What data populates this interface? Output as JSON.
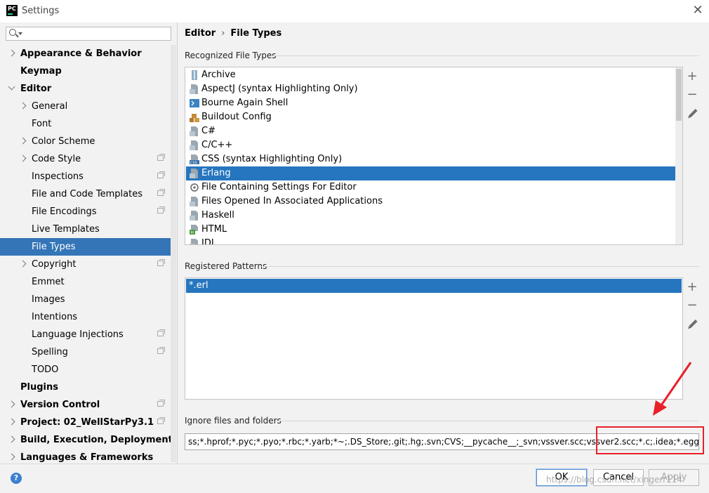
{
  "window": {
    "title": "Settings",
    "app_icon": "PC"
  },
  "search": {
    "placeholder": ""
  },
  "sidebar": {
    "items": [
      {
        "label": "Appearance & Behavior",
        "bold": true,
        "level": 0,
        "arrow": "right"
      },
      {
        "label": "Keymap",
        "bold": true,
        "level": 0,
        "arrow": ""
      },
      {
        "label": "Editor",
        "bold": true,
        "level": 0,
        "arrow": "down"
      },
      {
        "label": "General",
        "bold": false,
        "level": 1,
        "arrow": "right"
      },
      {
        "label": "Font",
        "bold": false,
        "level": 1,
        "arrow": ""
      },
      {
        "label": "Color Scheme",
        "bold": false,
        "level": 1,
        "arrow": "right"
      },
      {
        "label": "Code Style",
        "bold": false,
        "level": 1,
        "arrow": "right",
        "project": true
      },
      {
        "label": "Inspections",
        "bold": false,
        "level": 1,
        "arrow": "",
        "project": true
      },
      {
        "label": "File and Code Templates",
        "bold": false,
        "level": 1,
        "arrow": "",
        "project": true
      },
      {
        "label": "File Encodings",
        "bold": false,
        "level": 1,
        "arrow": "",
        "project": true
      },
      {
        "label": "Live Templates",
        "bold": false,
        "level": 1,
        "arrow": ""
      },
      {
        "label": "File Types",
        "bold": false,
        "level": 1,
        "arrow": "",
        "selected": true
      },
      {
        "label": "Copyright",
        "bold": false,
        "level": 1,
        "arrow": "right",
        "project": true
      },
      {
        "label": "Emmet",
        "bold": false,
        "level": 1,
        "arrow": ""
      },
      {
        "label": "Images",
        "bold": false,
        "level": 1,
        "arrow": ""
      },
      {
        "label": "Intentions",
        "bold": false,
        "level": 1,
        "arrow": ""
      },
      {
        "label": "Language Injections",
        "bold": false,
        "level": 1,
        "arrow": "",
        "project": true
      },
      {
        "label": "Spelling",
        "bold": false,
        "level": 1,
        "arrow": "",
        "project": true
      },
      {
        "label": "TODO",
        "bold": false,
        "level": 1,
        "arrow": ""
      },
      {
        "label": "Plugins",
        "bold": true,
        "level": 0,
        "arrow": ""
      },
      {
        "label": "Version Control",
        "bold": true,
        "level": 0,
        "arrow": "right",
        "project": true
      },
      {
        "label": "Project: 02_WellStarPy3.1",
        "bold": true,
        "level": 0,
        "arrow": "right",
        "project": true
      },
      {
        "label": "Build, Execution, Deployment",
        "bold": true,
        "level": 0,
        "arrow": "right"
      },
      {
        "label": "Languages & Frameworks",
        "bold": true,
        "level": 0,
        "arrow": "right"
      }
    ]
  },
  "breadcrumb": {
    "parent": "Editor",
    "separator": "›",
    "current": "File Types"
  },
  "recognized": {
    "label": "Recognized File Types",
    "items": [
      {
        "label": "Archive",
        "icon": "archive-icon"
      },
      {
        "label": "AspectJ (syntax Highlighting Only)",
        "icon": "file-icon"
      },
      {
        "label": "Bourne Again Shell",
        "icon": "shell-icon"
      },
      {
        "label": "Buildout Config",
        "icon": "buildout-icon"
      },
      {
        "label": "C#",
        "icon": "file-icon"
      },
      {
        "label": "C/C++",
        "icon": "file-icon"
      },
      {
        "label": "CSS (syntax Highlighting Only)",
        "icon": "css-icon"
      },
      {
        "label": "Erlang",
        "icon": "file-icon",
        "selected": true
      },
      {
        "label": "File Containing Settings For Editor",
        "icon": "editorconfig-icon"
      },
      {
        "label": "Files Opened In Associated Applications",
        "icon": "file-icon"
      },
      {
        "label": "Haskell",
        "icon": "file-icon"
      },
      {
        "label": "HTML",
        "icon": "html-icon"
      },
      {
        "label": "IDL",
        "icon": "file-icon"
      }
    ]
  },
  "patterns": {
    "label": "Registered Patterns",
    "items": [
      {
        "label": "*.erl",
        "selected": true
      }
    ]
  },
  "ignore": {
    "label": "Ignore files and folders",
    "value": "ss;*.hprof;*.pyc;*.pyo;*.rbc;*.yarb;*~;.DS_Store;.git;.hg;.svn;CVS;__pycache__;_svn;vssver.scc;vssver2.scc;*.c;.idea;*.egg-info;build;"
  },
  "buttons": {
    "ok": "OK",
    "cancel": "Cancel",
    "apply": "Apply",
    "help": "?"
  },
  "watermark": "https://blog.csdn.net/xingerr114",
  "colors": {
    "selection": "#2675bf",
    "sidebar_selection": "#3475b7",
    "annotation": "#e8202a"
  }
}
